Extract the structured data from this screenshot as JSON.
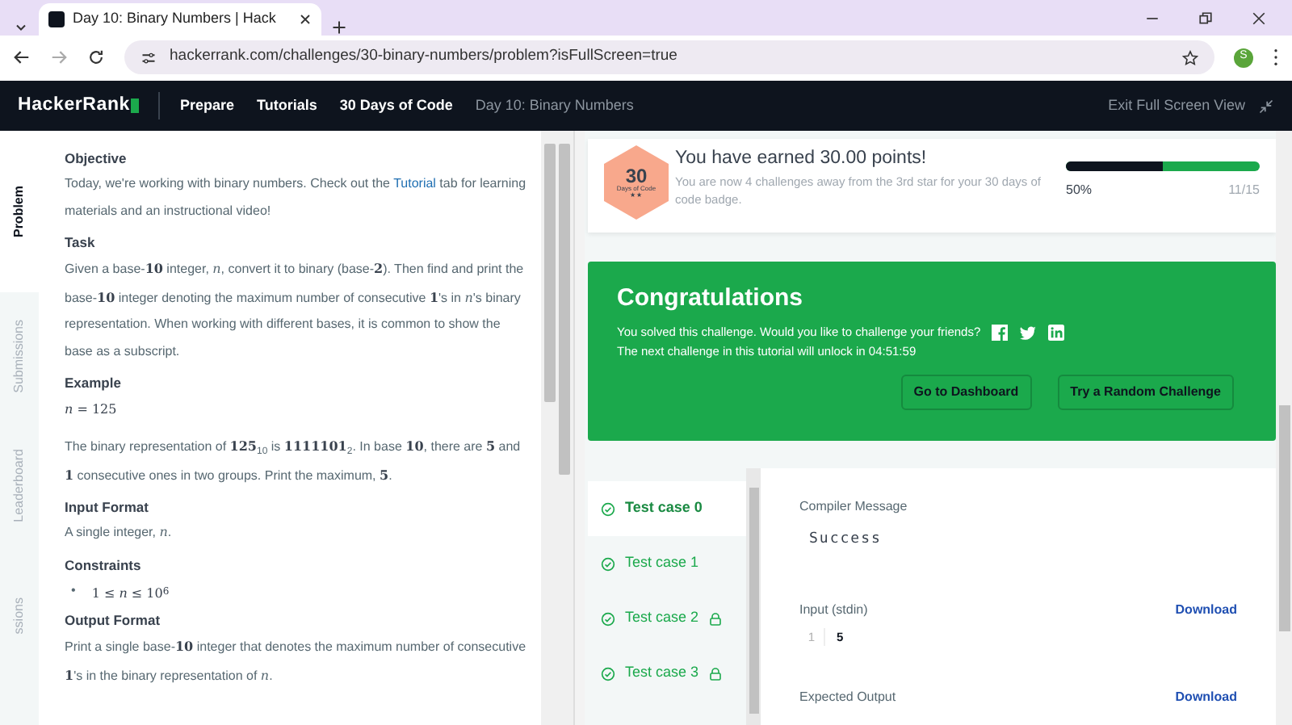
{
  "browser": {
    "tab_title": "Day 10: Binary Numbers | Hack",
    "url": "hackerrank.com/challenges/30-binary-numbers/problem?isFullScreen=true",
    "profile_initial": "S"
  },
  "nav": {
    "logo": "HackerRank",
    "links": [
      {
        "label": "Prepare",
        "current": false
      },
      {
        "label": "Tutorials",
        "current": false
      },
      {
        "label": "30 Days of Code",
        "current": false
      },
      {
        "label": "Day 10: Binary Numbers",
        "current": true
      }
    ],
    "exit": "Exit Full Screen View"
  },
  "side_tabs": [
    {
      "label": "Problem",
      "selected": true
    },
    {
      "label": "Submissions",
      "selected": false
    },
    {
      "label": "Leaderboard",
      "selected": false
    },
    {
      "label": "ssions",
      "selected": false
    }
  ],
  "problem": [
    {
      "kind": "heading",
      "text": "Objective"
    },
    {
      "kind": "link_para",
      "before": "Today, we're working with binary numbers. Check out the ",
      "link": "Tutorial",
      "after": " tab for learning materials and an instructional video!"
    },
    {
      "kind": "heading",
      "text": "Task"
    },
    {
      "kind": "para",
      "text": "Given a base-**10** integer, *n*, convert it to binary (base-**2**). Then find and print the base-**10** integer denoting the maximum number of consecutive **1**'s in *n*'s binary representation. When working with different bases, it is common to show the base as a subscript."
    },
    {
      "kind": "heading",
      "text": "Example"
    },
    {
      "kind": "math",
      "text": "*n* = 125"
    },
    {
      "kind": "para",
      "text": "The binary representation of **125**$_{10}$ is **1111101**$_{2}$. In base **10**, there are **5** and **1** consecutive ones in two groups. Print the maximum, **5**."
    },
    {
      "kind": "heading",
      "text": "Input Format"
    },
    {
      "kind": "para",
      "text": "A single integer, *n*."
    },
    {
      "kind": "heading",
      "text": "Constraints"
    },
    {
      "kind": "bullet",
      "marker": "•",
      "text": "1 ≤ *n* ≤ 10$^{6}$"
    },
    {
      "kind": "heading",
      "text": "Output Format"
    },
    {
      "kind": "para",
      "text": "Print a single base-**10** integer that denotes the maximum number of consecutive **1**'s in the binary representation of *n*."
    }
  ],
  "progress": {
    "badge_number": "30",
    "badge_label": "Days of Code",
    "badge_stars": "★★",
    "title": "You have earned 30.00 points!",
    "subtitle": "You are now 4 challenges away from the 3rd star for your 30 days of code badge.",
    "level": 0.5,
    "percent": "50%",
    "count": "11/15"
  },
  "congrats": {
    "title": "Congratulations",
    "message": "You solved this challenge. Would you like to challenge your friends?",
    "unlock": "The next challenge in this tutorial will unlock in 04:51:59",
    "buttons": [
      "Go to Dashboard",
      "Try a Random Challenge"
    ]
  },
  "test_cases": [
    {
      "label": "Test case 0",
      "selected": true,
      "locked": false
    },
    {
      "label": "Test case 1",
      "selected": false,
      "locked": false
    },
    {
      "label": "Test case 2",
      "selected": false,
      "locked": true
    },
    {
      "label": "Test case 3",
      "selected": false,
      "locked": true
    }
  ],
  "result": {
    "compiler_label": "Compiler Message",
    "compiler_message": "Success",
    "input_label": "Input (stdin)",
    "input_download": "Download",
    "input_lines": [
      {
        "number": "1",
        "text": "5"
      }
    ],
    "expected_label": "Expected Output",
    "expected_download": "Download"
  }
}
